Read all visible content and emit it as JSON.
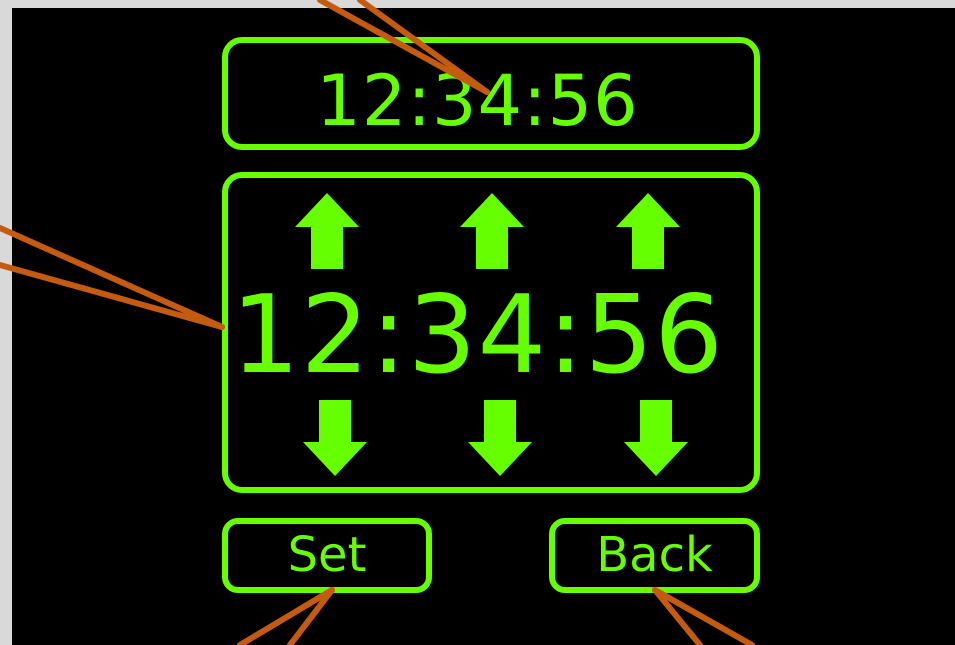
{
  "display": {
    "current_time": "12:34:56",
    "edit_time": "12:34:56"
  },
  "buttons": {
    "set_label": "Set",
    "back_label": "Back"
  },
  "icons": {
    "up": "arrow-up-icon",
    "down": "arrow-down-icon"
  },
  "colors": {
    "accent": "#66ff00",
    "background": "#000000",
    "frame": "#d9d9d9",
    "annotation": "#c55a11"
  }
}
